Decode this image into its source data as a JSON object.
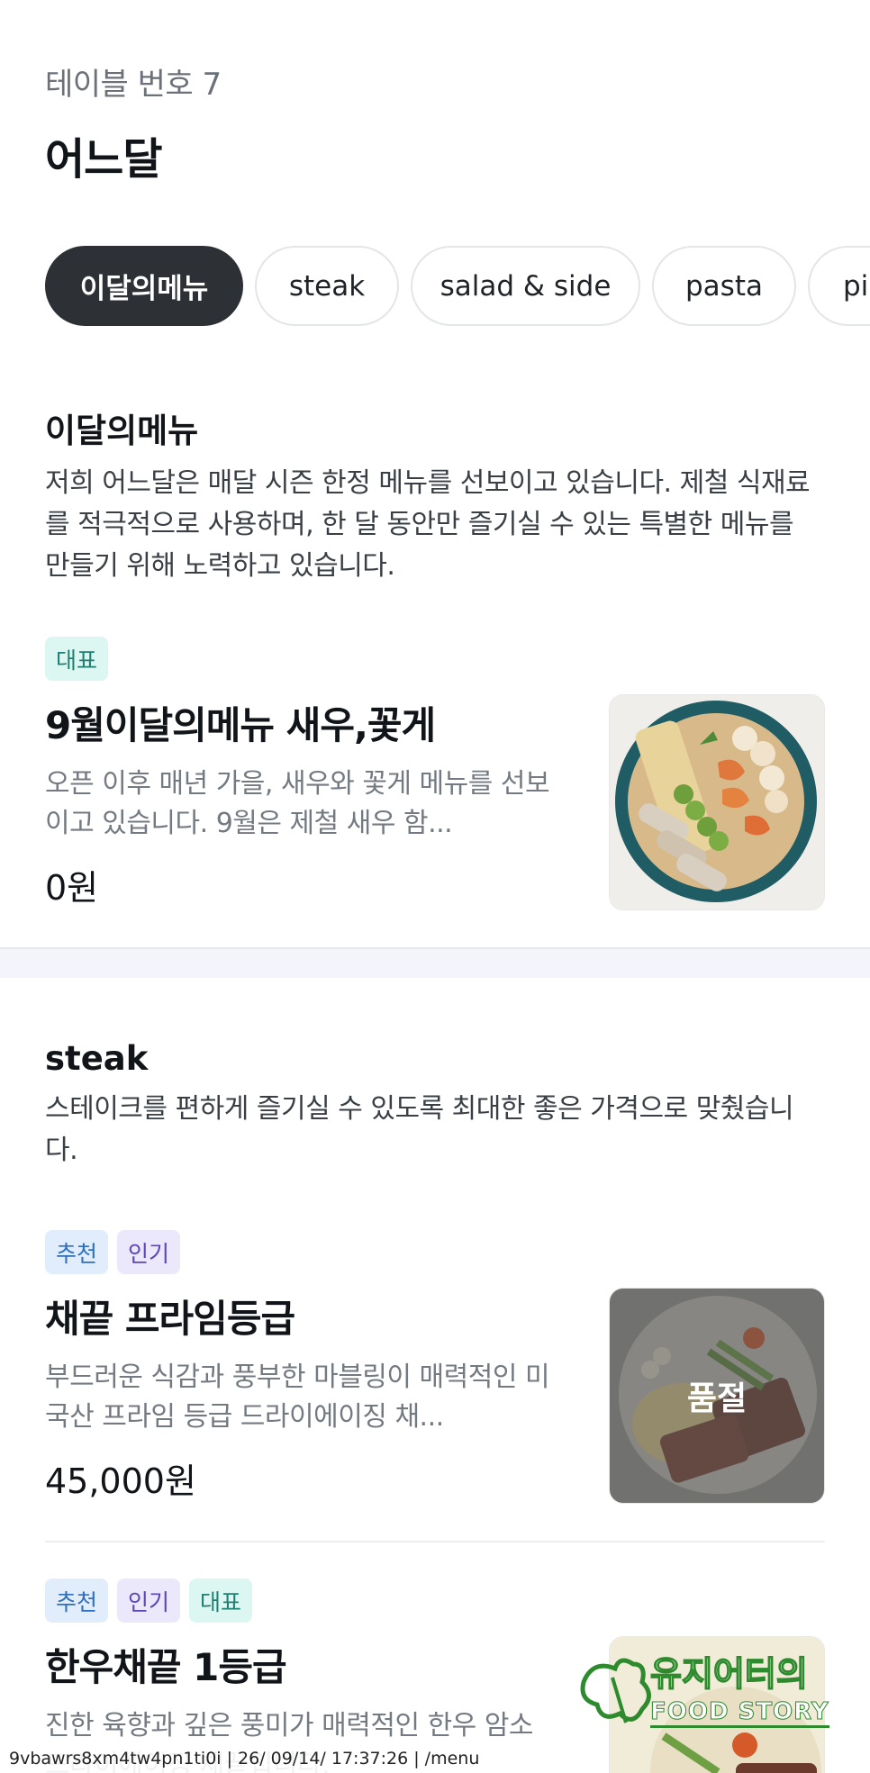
{
  "header": {
    "table_label": "테이블 번호 7",
    "store_name": "어느달"
  },
  "tabs": [
    "이달의메뉴",
    "steak",
    "salad & side",
    "pasta",
    "pi"
  ],
  "sections": [
    {
      "title": "이달의메뉴",
      "description": "저희 어느달은 매달 시즌 한정 메뉴를 선보이고 있습니다. 제철 식재료를 적극적으로 사용하며, 한 달 동안만 즐기실 수 있는 특별한 메뉴를 만들기 위해 노력하고 있습니다.",
      "items": [
        {
          "badges": [
            "대표"
          ],
          "name": "9월이달의메뉴 새우,꽃게",
          "description": "오픈 이후 매년 가을, 새우와 꽃게 메뉴를 선보이고 있습니다. 9월은 제철 새우 함...",
          "price": "0원"
        }
      ]
    },
    {
      "title": "steak",
      "description": "스테이크를 편하게 즐기실 수 있도록 최대한 좋은 가격으로 맞췄습니다.",
      "items": [
        {
          "badges": [
            "추천",
            "인기"
          ],
          "name": "채끝 프라임등급",
          "description": "부드러운 식감과 풍부한 마블링이 매력적인 미국산 프라임 등급 드라이에이징 채...",
          "price": "45,000원",
          "status": "품절"
        },
        {
          "badges": [
            "추천",
            "인기",
            "대표"
          ],
          "name": "한우채끝 1등급",
          "description": "진한 육향과 깊은 풍미가 매력적인 한우 암소 드라이에이징 채끝입니다."
        }
      ]
    }
  ],
  "watermark": {
    "line1": "유지어터의",
    "line2": "FOOD STORY"
  },
  "footer": "9vbawrs8xm4tw4pn1ti0i | 26/ 09/14/ 17:37:26 | /menu",
  "colors": {
    "active_tab": "#2d3035",
    "badge_mint": "#dcf6f1",
    "badge_blue": "#e2edfb",
    "badge_purple": "#ece8fb"
  }
}
